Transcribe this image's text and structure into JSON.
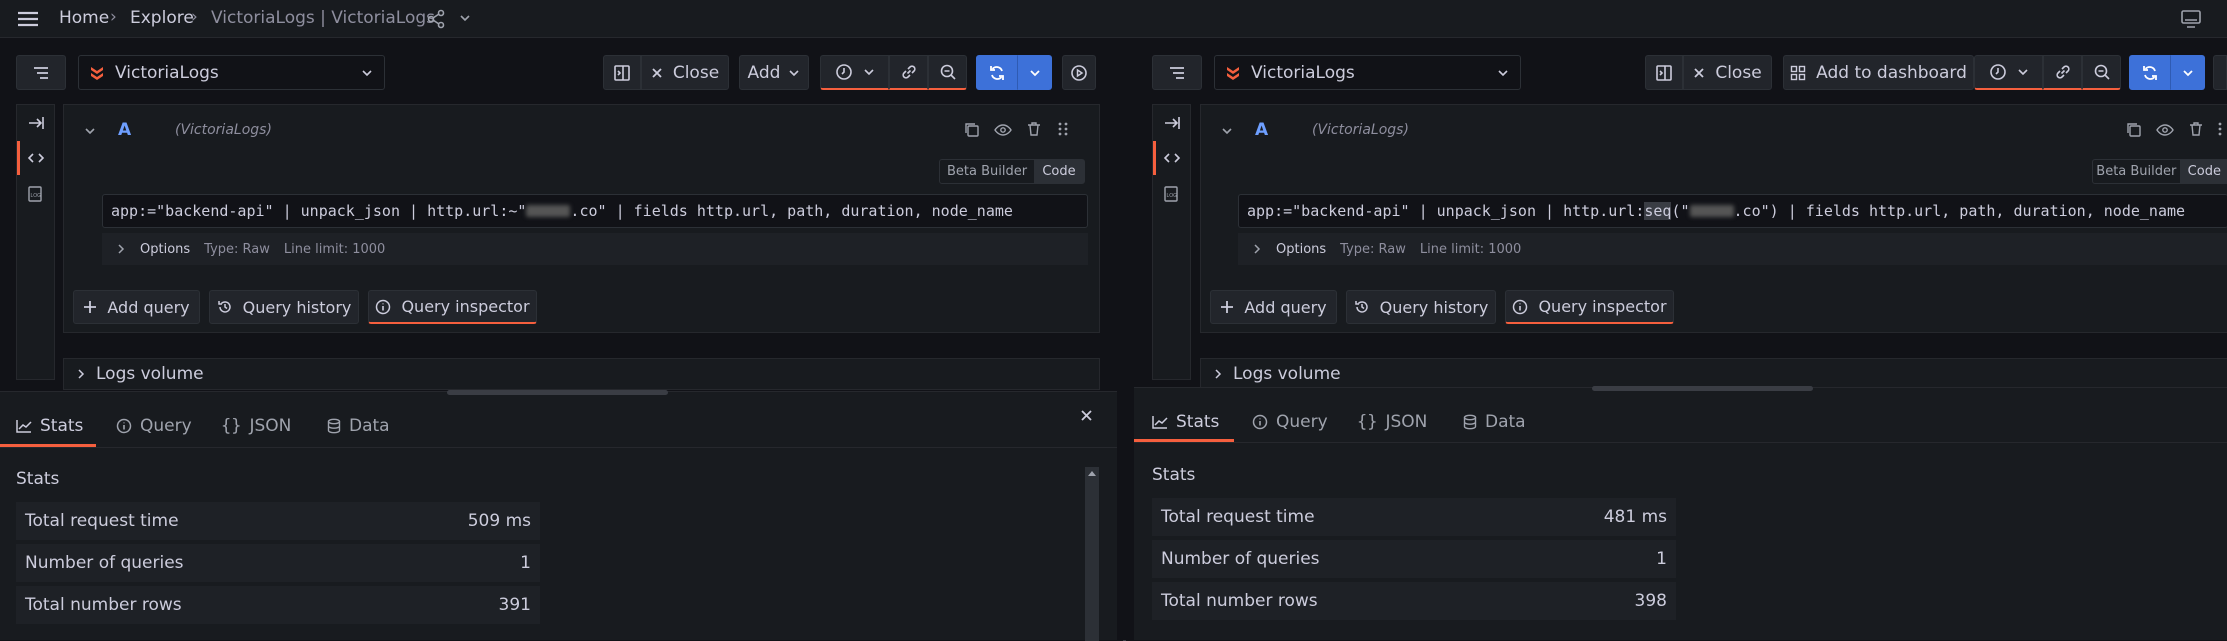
{
  "nav": {
    "home": "Home",
    "explore": "Explore",
    "title": "VictoriaLogs | VictoriaLogs"
  },
  "left": {
    "datasource": "VictoriaLogs",
    "close_label": "Close",
    "add_label": "Add",
    "query_letter": "A",
    "query_ds": "(VictoriaLogs)",
    "builder_label": "Beta Builder",
    "code_label": "Code",
    "query_pre": "app:=\"backend-api\" | unpack_json | http.url:~\"",
    "query_post": ".co\" | fields http.url, path, duration, node_name",
    "options_label": "Options",
    "type_text": "Type: Raw",
    "limit_text": "Line limit: 1000",
    "add_query": "Add query",
    "query_history": "Query history",
    "query_inspector": "Query inspector",
    "logs_volume": "Logs volume",
    "tabs": [
      "Stats",
      "Query",
      "JSON",
      "Data"
    ],
    "stats_heading": "Stats",
    "stats": [
      {
        "label": "Total request time",
        "value": "509 ms"
      },
      {
        "label": "Number of queries",
        "value": "1"
      },
      {
        "label": "Total number rows",
        "value": "391"
      }
    ]
  },
  "right": {
    "datasource": "VictoriaLogs",
    "close_label": "Close",
    "add_label": "Add to dashboard",
    "query_letter": "A",
    "query_ds": "(VictoriaLogs)",
    "builder_label": "Beta Builder",
    "code_label": "Code",
    "query_pre": "app:=\"backend-api\" | unpack_json | http.url:",
    "query_seq": "seq",
    "query_mid": "(\"",
    "query_post": ".co\") | fields http.url, path, duration, node_name",
    "options_label": "Options",
    "type_text": "Type: Raw",
    "limit_text": "Line limit: 1000",
    "add_query": "Add query",
    "query_history": "Query history",
    "query_inspector": "Query inspector",
    "logs_volume": "Logs volume",
    "tabs": [
      "Stats",
      "Query",
      "JSON",
      "Data"
    ],
    "stats_heading": "Stats",
    "stats": [
      {
        "label": "Total request time",
        "value": "481 ms"
      },
      {
        "label": "Number of queries",
        "value": "1"
      },
      {
        "label": "Total number rows",
        "value": "398"
      }
    ]
  },
  "colors": {
    "accent": "#f55f3e",
    "primary": "#3d71d9",
    "background": "#111217",
    "panel": "#181b1f"
  }
}
